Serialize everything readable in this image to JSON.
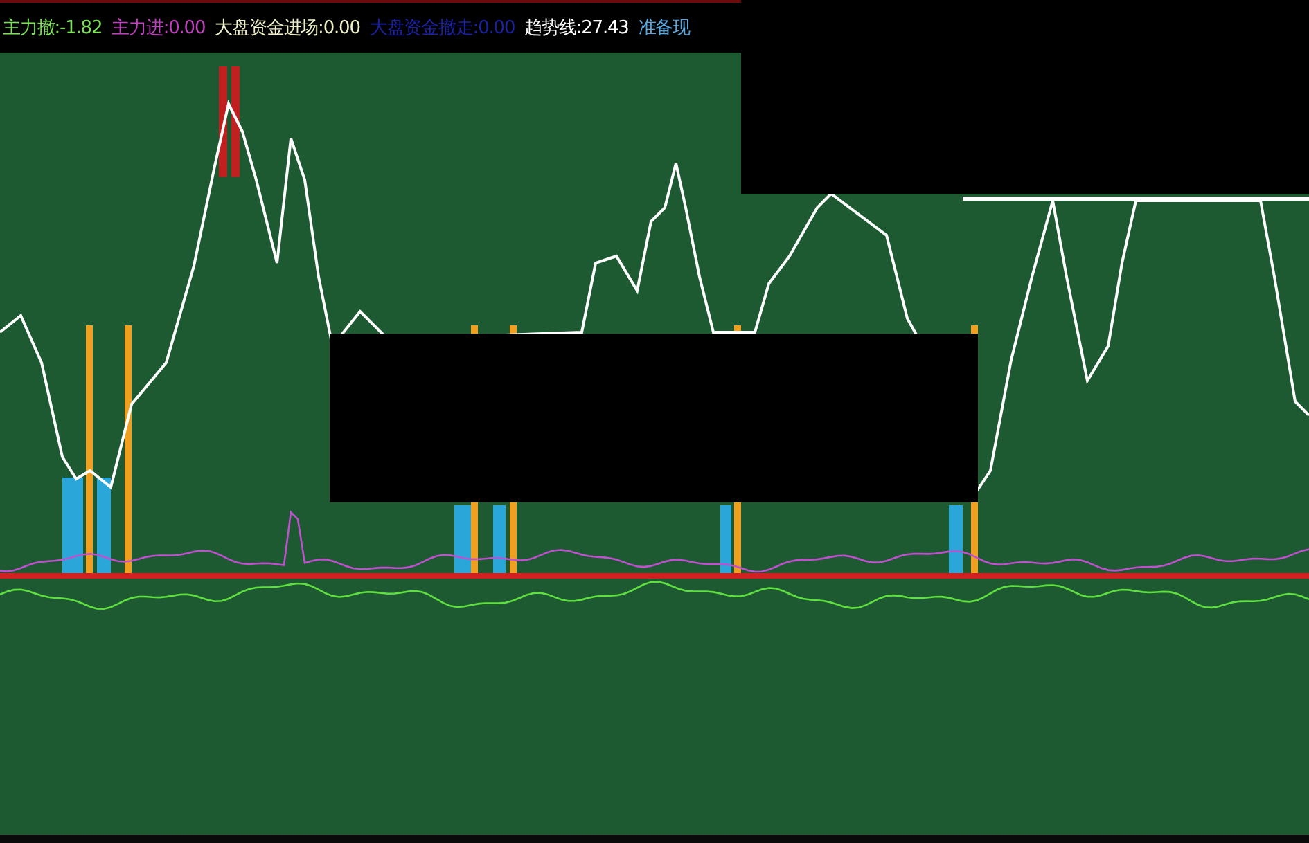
{
  "header": {
    "indicators": [
      {
        "text": "主力撤:-1.82",
        "color": "#7ee05a"
      },
      {
        "text": "主力进:0.00",
        "color": "#c040c0"
      },
      {
        "text": "大盘资金进场:0.00",
        "color": "#f0f0c8"
      },
      {
        "text": "大盘资金撤走:0.00",
        "color": "#1a22a0"
      },
      {
        "text": "趋势线:27.43",
        "color": "#ffffff"
      },
      {
        "text": "准备现",
        "color": "#5aa8e0"
      }
    ]
  }
}
